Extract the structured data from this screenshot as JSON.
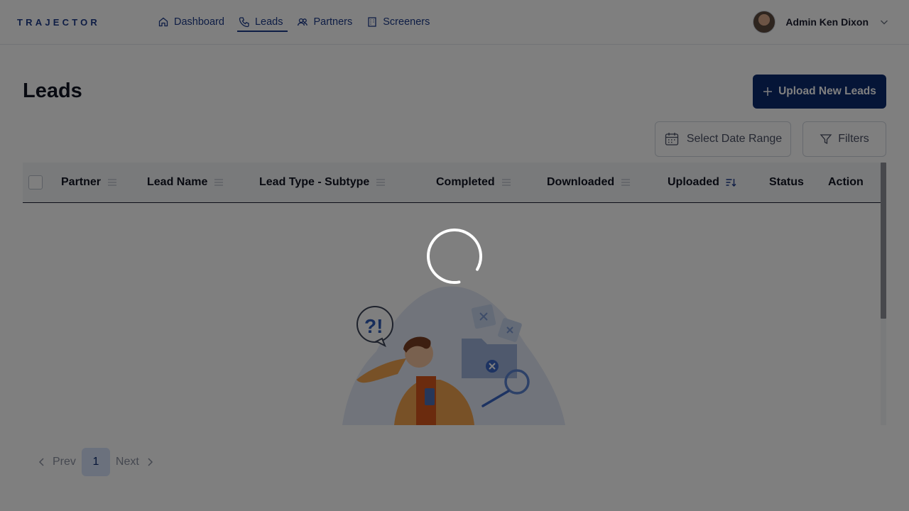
{
  "brand": {
    "logo_text": "TRAJECTOR"
  },
  "nav": {
    "items": [
      {
        "label": "Dashboard",
        "icon": "home-icon"
      },
      {
        "label": "Leads",
        "icon": "phone-icon",
        "active": true
      },
      {
        "label": "Partners",
        "icon": "users-icon"
      },
      {
        "label": "Screeners",
        "icon": "building-icon"
      }
    ]
  },
  "user": {
    "name": "Admin Ken Dixon",
    "icon": "chevron-down-icon"
  },
  "page": {
    "title": "Leads",
    "upload_label": "Upload New Leads",
    "date_range_label": "Select Date Range",
    "filters_label": "Filters"
  },
  "table": {
    "columns": [
      {
        "label": "Partner",
        "icon": "menu-icon"
      },
      {
        "label": "Lead Name",
        "icon": "menu-icon"
      },
      {
        "label": "Lead Type - Subtype",
        "icon": "menu-icon"
      },
      {
        "label": "Completed",
        "icon": "menu-icon"
      },
      {
        "label": "Downloaded",
        "icon": "menu-icon"
      },
      {
        "label": "Uploaded",
        "icon": "sort-descending-icon"
      },
      {
        "label": "Status"
      },
      {
        "label": "Action"
      }
    ]
  },
  "pagination": {
    "prev_label": "Prev",
    "current_page": "1",
    "next_label": "Next"
  },
  "loading": {
    "state": "spinner-visible"
  },
  "colors": {
    "primary": "#0b2a6f",
    "accent": "#e0483b",
    "nav": "#1c3a8a"
  }
}
